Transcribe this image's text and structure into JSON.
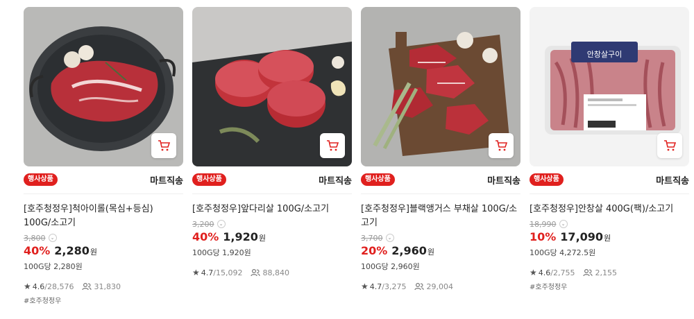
{
  "products": [
    {
      "badge": "행사상품",
      "seller": "마트직송",
      "title": "[호주청정우]척아이롤(목심+등심) 100G/소고기",
      "original_price": "3,800",
      "discount": "40%",
      "price": "2,280",
      "currency": "원",
      "unit_price": "100G당 2,280원",
      "rating": "4.6",
      "review_count": "/28,576",
      "views": "31,830",
      "tag": "#호주청정우",
      "image_subject": "chuck-eye-roll-steak-on-pan"
    },
    {
      "badge": "행사상품",
      "seller": "마트직송",
      "title": "[호주청정우]앞다리살 100G/소고기",
      "original_price": "3,200",
      "discount": "40%",
      "price": "1,920",
      "currency": "원",
      "unit_price": "100G당 1,920원",
      "rating": "4.7",
      "review_count": "/15,092",
      "views": "88,840",
      "tag": "",
      "image_subject": "beef-shoulder-rolls-on-slate"
    },
    {
      "badge": "행사상품",
      "seller": "마트직송",
      "title": "[호주청정우]블랙앵거스 부채살 100G/소고기",
      "original_price": "3,700",
      "discount": "20%",
      "price": "2,960",
      "currency": "원",
      "unit_price": "100G당 2,960원",
      "rating": "4.7",
      "review_count": "/3,275",
      "views": "29,004",
      "tag": "",
      "image_subject": "top-blade-steaks-on-board"
    },
    {
      "badge": "행사상품",
      "seller": "마트직송",
      "title": "[호주청정우]안창살 400G(팩)/소고기",
      "original_price": "18,990",
      "discount": "10%",
      "price": "17,090",
      "currency": "원",
      "unit_price": "100G당 4,272.5원",
      "rating": "4.6",
      "review_count": "/2,755",
      "views": "2,155",
      "tag": "#호주청정우",
      "image_subject": "packaged-skirt-meat-tray",
      "package_label": "안창살구이"
    }
  ],
  "colors": {
    "accent": "#e0201e",
    "muted": "#999999"
  },
  "icons": {
    "cart": "cart-icon",
    "star": "star-icon",
    "views": "people-icon",
    "chevron": "chevron-down-icon"
  }
}
